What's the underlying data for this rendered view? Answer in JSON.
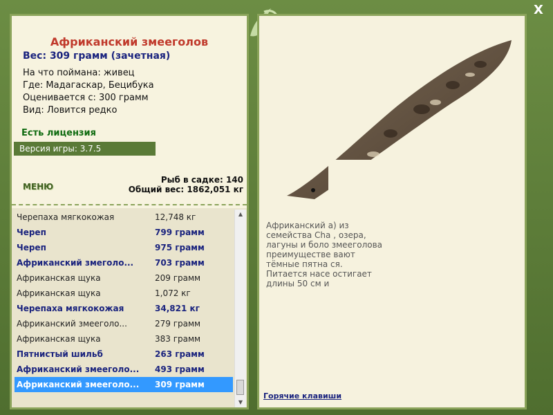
{
  "window": {
    "close_label": "X"
  },
  "fish": {
    "title": "Африканский змееголов",
    "weight_line": "Вес: 309 грамм (зачетная)",
    "details": [
      "На что поймана: живец",
      "Где: Мадагаскар, Бецибука",
      "Оценивается с: 300 грамм",
      "Вид: Ловится редко"
    ],
    "license": "Есть лицензия",
    "version": "Версия игры: 3.7.5"
  },
  "menu_label": "МЕНЮ",
  "stats": {
    "fish_count": "Рыб в садке: 140",
    "total_weight": "Общий вес: 1862,051 кг"
  },
  "catch_list": [
    {
      "name": "Черепаха мягкокожая",
      "weight": "12,748 кг",
      "bold": false,
      "selected": false
    },
    {
      "name": "Череп",
      "weight": "799 грамм",
      "bold": true,
      "selected": false
    },
    {
      "name": "Череп",
      "weight": "975 грамм",
      "bold": true,
      "selected": false
    },
    {
      "name": "Африканский змеголо...",
      "weight": "703 грамм",
      "bold": true,
      "selected": false
    },
    {
      "name": "Африканская щука",
      "weight": "209 грамм",
      "bold": false,
      "selected": false
    },
    {
      "name": "Африканская щука",
      "weight": "1,072 кг",
      "bold": false,
      "selected": false
    },
    {
      "name": "Черепаха мягкокожая",
      "weight": "34,821 кг",
      "bold": true,
      "selected": false
    },
    {
      "name": "Африканский змееголо...",
      "weight": "279 грамм",
      "bold": false,
      "selected": false
    },
    {
      "name": "Африканская щука",
      "weight": "383 грамм",
      "bold": false,
      "selected": false
    },
    {
      "name": "Пятнистый шильб",
      "weight": "263 грамм",
      "bold": true,
      "selected": false
    },
    {
      "name": "Африканский змееголо...",
      "weight": "493 грамм",
      "bold": true,
      "selected": false
    },
    {
      "name": "Африканский змееголо...",
      "weight": "309 грамм",
      "bold": false,
      "selected": true
    }
  ],
  "description": {
    "lines": [
      "Африканский                               a) из",
      "семейства Cha                              , озера,",
      "лагуны и боло                            змеeголова",
      "преимуществе                             вают",
      "тёмные пятна                              ся.",
      "Питается насе                           остигает",
      "длины 50 см и"
    ]
  },
  "hotkeys_label": "Горячие клавиши",
  "icons": {
    "logo": "lizard-logo-icon",
    "close": "close-icon"
  }
}
